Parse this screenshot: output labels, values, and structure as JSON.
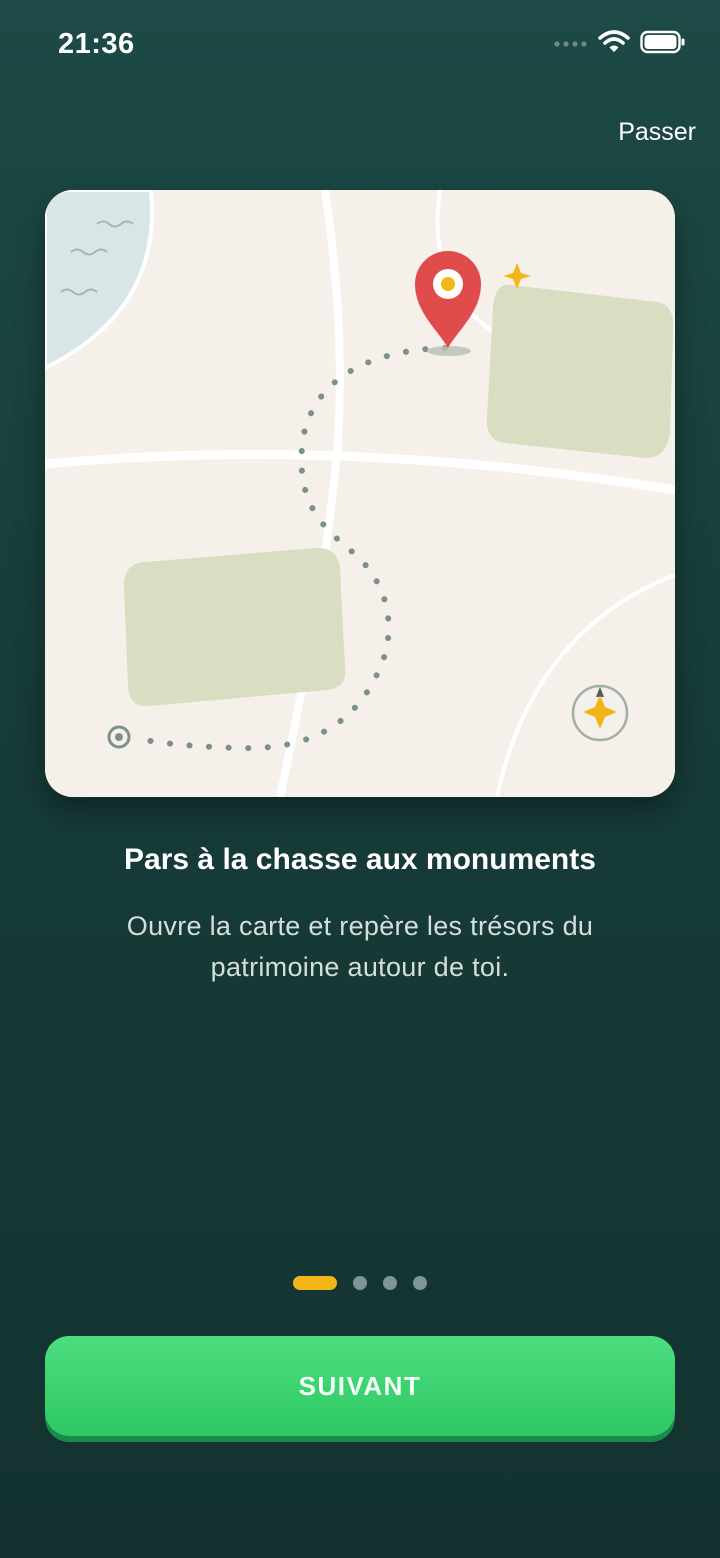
{
  "status_bar": {
    "time": "21:36",
    "icons": [
      "cellular-signal-icon",
      "wifi-icon",
      "battery-icon"
    ]
  },
  "header": {
    "skip_label": "Passer"
  },
  "illustration": {
    "icons": [
      "map-pin-icon",
      "sparkle-icon",
      "compass-sparkle-icon",
      "start-point-icon",
      "water-waves-icon"
    ],
    "colors": {
      "card_background": "#f5f0e9",
      "water": "#d9e6e8",
      "park": "#d9ddc1",
      "road": "#ffffff",
      "path_dots": "#7c918c",
      "pin": "#e04b4c",
      "accent": "#f2b619"
    }
  },
  "onboarding": {
    "title": "Pars à la chasse aux monuments",
    "description": "Ouvre la carte et repère les trésors du patrimoine autour de toi."
  },
  "pager": {
    "current_page": 1,
    "total_pages": 4
  },
  "footer": {
    "next_label": "SUIVANT"
  },
  "colors": {
    "background_top": "#1d4a46",
    "background_bottom": "#133230",
    "primary_button": "#3fd573",
    "pager_active": "#f2b619",
    "pager_inactive": "#7f9693"
  }
}
